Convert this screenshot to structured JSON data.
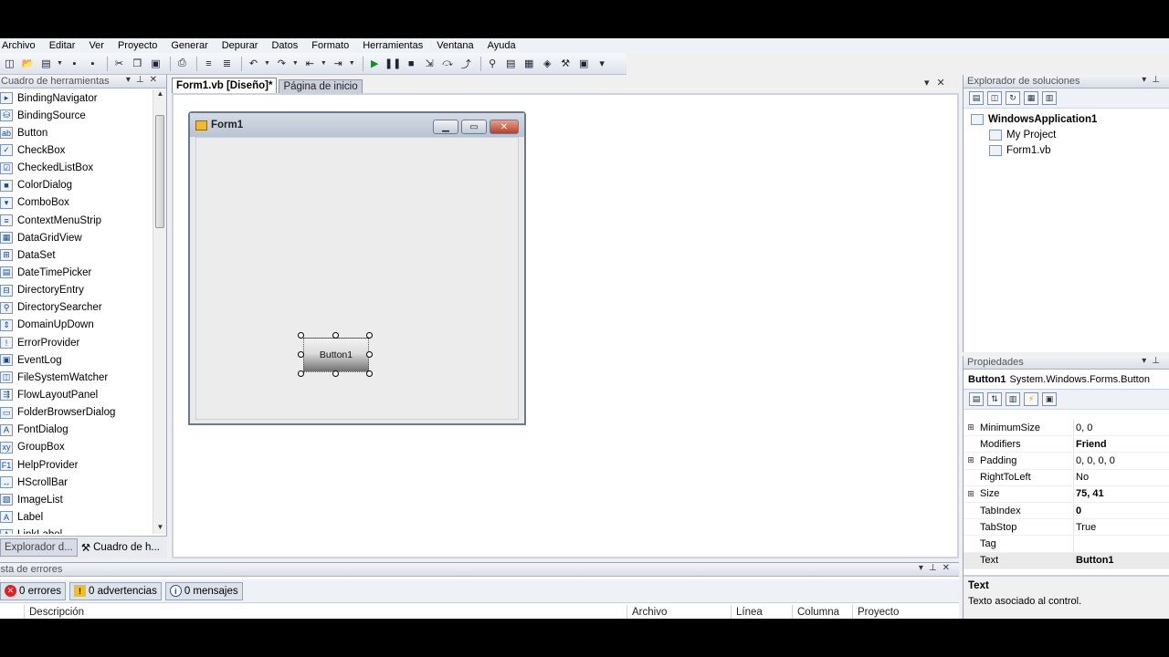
{
  "menu": [
    "Archivo",
    "Editar",
    "Ver",
    "Proyecto",
    "Generar",
    "Depurar",
    "Datos",
    "Formato",
    "Herramientas",
    "Ventana",
    "Ayuda"
  ],
  "toolbox": {
    "title": "Cuadro de herramientas",
    "items": [
      {
        "label": "BindingNavigator",
        "icon": "binding-navigator-icon",
        "glyph": "▸"
      },
      {
        "label": "BindingSource",
        "icon": "binding-source-icon",
        "glyph": "⛁"
      },
      {
        "label": "Button",
        "icon": "button-icon",
        "glyph": "ab"
      },
      {
        "label": "CheckBox",
        "icon": "checkbox-icon",
        "glyph": "✓"
      },
      {
        "label": "CheckedListBox",
        "icon": "checked-list-box-icon",
        "glyph": "☑"
      },
      {
        "label": "ColorDialog",
        "icon": "color-dialog-icon",
        "glyph": "■"
      },
      {
        "label": "ComboBox",
        "icon": "combobox-icon",
        "glyph": "▾"
      },
      {
        "label": "ContextMenuStrip",
        "icon": "context-menu-strip-icon",
        "glyph": "≡"
      },
      {
        "label": "DataGridView",
        "icon": "data-grid-view-icon",
        "glyph": "▦"
      },
      {
        "label": "DataSet",
        "icon": "dataset-icon",
        "glyph": "⊞"
      },
      {
        "label": "DateTimePicker",
        "icon": "date-time-picker-icon",
        "glyph": "▤"
      },
      {
        "label": "DirectoryEntry",
        "icon": "directory-entry-icon",
        "glyph": "⊟"
      },
      {
        "label": "DirectorySearcher",
        "icon": "directory-searcher-icon",
        "glyph": "⚲"
      },
      {
        "label": "DomainUpDown",
        "icon": "domain-up-down-icon",
        "glyph": "⇕"
      },
      {
        "label": "ErrorProvider",
        "icon": "error-provider-icon",
        "glyph": "!"
      },
      {
        "label": "EventLog",
        "icon": "event-log-icon",
        "glyph": "▣"
      },
      {
        "label": "FileSystemWatcher",
        "icon": "file-system-watcher-icon",
        "glyph": "◫"
      },
      {
        "label": "FlowLayoutPanel",
        "icon": "flow-layout-panel-icon",
        "glyph": "⇶"
      },
      {
        "label": "FolderBrowserDialog",
        "icon": "folder-browser-dialog-icon",
        "glyph": "▭"
      },
      {
        "label": "FontDialog",
        "icon": "font-dialog-icon",
        "glyph": "A"
      },
      {
        "label": "GroupBox",
        "icon": "group-box-icon",
        "glyph": "xy"
      },
      {
        "label": "HelpProvider",
        "icon": "help-provider-icon",
        "glyph": "F1"
      },
      {
        "label": "HScrollBar",
        "icon": "hscrollbar-icon",
        "glyph": "↔"
      },
      {
        "label": "ImageList",
        "icon": "image-list-icon",
        "glyph": "▧"
      },
      {
        "label": "Label",
        "icon": "label-icon",
        "glyph": "A"
      },
      {
        "label": "LinkLabel",
        "icon": "link-label-icon",
        "glyph": "A"
      }
    ],
    "tabs": [
      "Explorador d...",
      "Cuadro de h..."
    ]
  },
  "document": {
    "tabs": [
      {
        "label": "Form1.vb [Diseño]*",
        "active": true
      },
      {
        "label": "Página de inicio",
        "active": false
      }
    ]
  },
  "form1": {
    "title": "Form1",
    "button_text": "Button1"
  },
  "solution_explorer": {
    "title": "Explorador de soluciones",
    "project": "WindowsApplication1",
    "children": [
      "My Project",
      "Form1.vb"
    ]
  },
  "properties": {
    "title": "Propiedades",
    "object_name": "Button1",
    "object_type": "System.Windows.Forms.Button",
    "rows": [
      {
        "name": "MinimumSize",
        "value": "0, 0",
        "expandable": true,
        "bold": false
      },
      {
        "name": "Modifiers",
        "value": "Friend",
        "expandable": false,
        "bold": true
      },
      {
        "name": "Padding",
        "value": "0, 0, 0, 0",
        "expandable": true,
        "bold": false
      },
      {
        "name": "RightToLeft",
        "value": "No",
        "expandable": false,
        "bold": false
      },
      {
        "name": "Size",
        "value": "75, 41",
        "expandable": true,
        "bold": true
      },
      {
        "name": "TabIndex",
        "value": "0",
        "expandable": false,
        "bold": true
      },
      {
        "name": "TabStop",
        "value": "True",
        "expandable": false,
        "bold": false
      },
      {
        "name": "Tag",
        "value": "",
        "expandable": false,
        "bold": false
      },
      {
        "name": "Text",
        "value": "Button1",
        "expandable": false,
        "bold": true
      }
    ],
    "description_title": "Text",
    "description_text": "Texto asociado al control."
  },
  "error_list": {
    "title": "Lista de errores",
    "errors": "0 errores",
    "warnings": "0 advertencias",
    "messages": "0 mensajes",
    "columns": [
      "Descripción",
      "Archivo",
      "Línea",
      "Columna",
      "Proyecto"
    ]
  }
}
